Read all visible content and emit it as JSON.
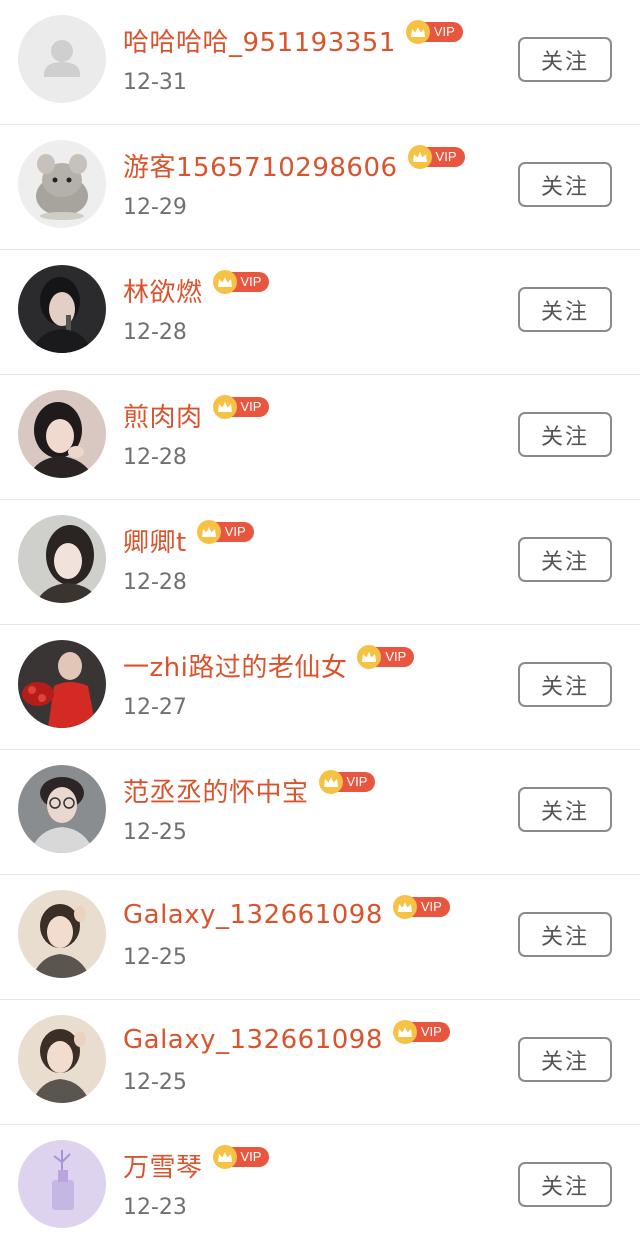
{
  "colors": {
    "name": "#d9542d",
    "date": "#707070",
    "vip_tag": "#e8563f",
    "vip_crown": "#f6c244",
    "button_border": "#8a8a8a"
  },
  "follow_label": "关注",
  "vip_label": "VIP",
  "users": [
    {
      "name": "哈哈哈哈_951193351",
      "date": "12-31",
      "avatar": "default-avatar-icon"
    },
    {
      "name": "游客1565710298606",
      "date": "12-29",
      "avatar": "chinchilla-photo"
    },
    {
      "name": "林欲燃",
      "date": "12-28",
      "avatar": "user-photo"
    },
    {
      "name": "煎肉肉",
      "date": "12-28",
      "avatar": "user-photo"
    },
    {
      "name": "卿卿t",
      "date": "12-28",
      "avatar": "user-photo"
    },
    {
      "name": "一zhi路过的老仙女",
      "date": "12-27",
      "avatar": "user-photo"
    },
    {
      "name": "范丞丞的怀中宝",
      "date": "12-25",
      "avatar": "user-photo"
    },
    {
      "name": "Galaxy_132661098",
      "date": "12-25",
      "avatar": "user-photo"
    },
    {
      "name": "Galaxy_132661098",
      "date": "12-25",
      "avatar": "user-photo"
    },
    {
      "name": "万雪琴",
      "date": "12-23",
      "avatar": "user-photo"
    }
  ]
}
